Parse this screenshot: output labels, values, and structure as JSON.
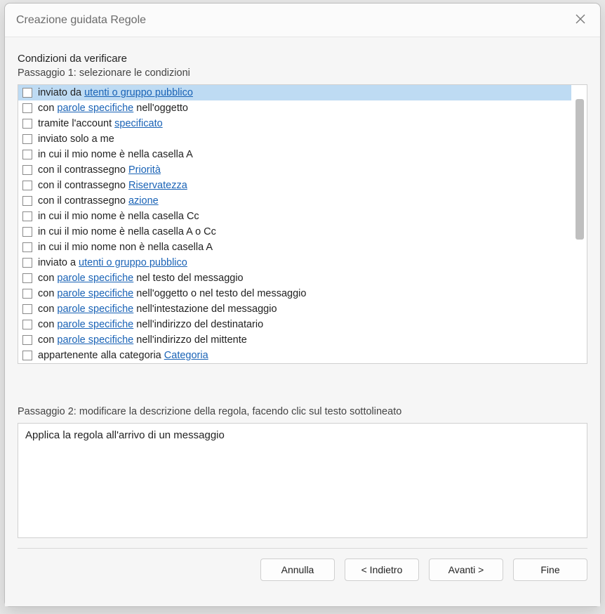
{
  "dialog": {
    "title": "Creazione guidata Regole"
  },
  "step1": {
    "heading": "Condizioni da verificare",
    "label": "Passaggio 1: selezionare le condizioni",
    "conditions": [
      {
        "selected": true,
        "pre": "inviato da ",
        "link": "utenti o gruppo pubblico",
        "post": ""
      },
      {
        "selected": false,
        "pre": "con ",
        "link": "parole specifiche",
        "post": " nell'oggetto"
      },
      {
        "selected": false,
        "pre": "tramite l'account ",
        "link": "specificato",
        "post": ""
      },
      {
        "selected": false,
        "pre": "inviato solo a me",
        "link": "",
        "post": ""
      },
      {
        "selected": false,
        "pre": "in cui il mio nome è nella casella A",
        "link": "",
        "post": ""
      },
      {
        "selected": false,
        "pre": "con il contrassegno ",
        "link": "Priorità",
        "post": ""
      },
      {
        "selected": false,
        "pre": "con il contrassegno ",
        "link": "Riservatezza",
        "post": ""
      },
      {
        "selected": false,
        "pre": "con il contrassegno ",
        "link": "azione",
        "post": ""
      },
      {
        "selected": false,
        "pre": "in cui il mio nome è nella casella Cc",
        "link": "",
        "post": ""
      },
      {
        "selected": false,
        "pre": "in cui il mio nome è nella casella A o Cc",
        "link": "",
        "post": ""
      },
      {
        "selected": false,
        "pre": "in cui il mio nome non è nella casella A",
        "link": "",
        "post": ""
      },
      {
        "selected": false,
        "pre": "inviato a ",
        "link": "utenti o gruppo pubblico",
        "post": ""
      },
      {
        "selected": false,
        "pre": "con ",
        "link": "parole specifiche",
        "post": " nel testo del messaggio"
      },
      {
        "selected": false,
        "pre": "con ",
        "link": "parole specifiche",
        "post": " nell'oggetto o nel testo del messaggio"
      },
      {
        "selected": false,
        "pre": "con ",
        "link": "parole specifiche",
        "post": " nell'intestazione del messaggio"
      },
      {
        "selected": false,
        "pre": "con ",
        "link": "parole specifiche",
        "post": " nell'indirizzo del destinatario"
      },
      {
        "selected": false,
        "pre": "con ",
        "link": "parole specifiche",
        "post": " nell'indirizzo del mittente"
      },
      {
        "selected": false,
        "pre": "appartenente alla categoria ",
        "link": "Categoria",
        "post": ""
      }
    ]
  },
  "step2": {
    "label": "Passaggio 2: modificare la descrizione della regola, facendo clic sul testo sottolineato",
    "description": "Applica la regola all'arrivo di un messaggio"
  },
  "buttons": {
    "cancel": "Annulla",
    "back": "<  Indietro",
    "next": "Avanti  >",
    "finish": "Fine"
  }
}
